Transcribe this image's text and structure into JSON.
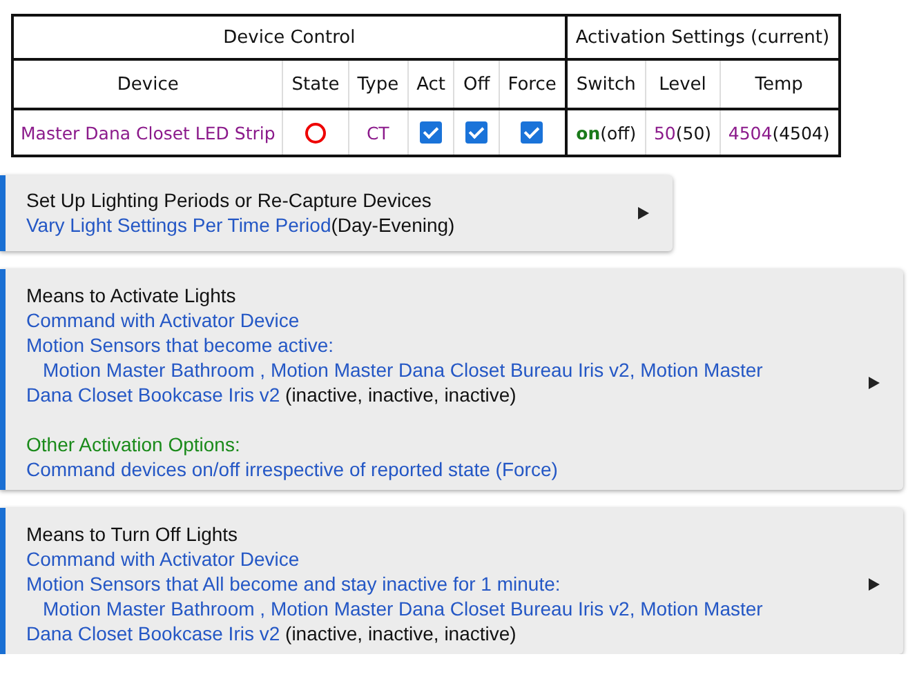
{
  "device_table": {
    "column_groups": [
      {
        "label": "Device Control",
        "columns": [
          "Device",
          "State",
          "Type",
          "Act",
          "Off",
          "Force"
        ]
      },
      {
        "label": "Activation Settings (current)",
        "columns": [
          "Switch",
          "Level",
          "Temp"
        ]
      }
    ],
    "rows": [
      {
        "device": "Master Dana Closet LED Strip",
        "state_on": false,
        "type": "CT",
        "act": {
          "checked": true
        },
        "off": {
          "checked": true
        },
        "force": {
          "checked": true
        },
        "switch": {
          "value": "on",
          "current": "(off)"
        },
        "level": {
          "value": "50",
          "current": "(50)"
        },
        "temp": {
          "value": "4504",
          "current": "(4504)"
        }
      }
    ]
  },
  "panels": [
    {
      "title": "Set Up Lighting Periods or Re-Capture Devices",
      "wide": false,
      "lines": [
        {
          "kind": "link-note",
          "text": "Vary Light Settings Per Time Period",
          "note": "(Day-Evening)"
        }
      ]
    },
    {
      "title": "Means to Activate Lights",
      "wide": true,
      "lines": [
        {
          "kind": "link",
          "text": "Command with Activator Device"
        },
        {
          "kind": "link",
          "text": "Motion Sensors that become active:"
        },
        {
          "kind": "sensors",
          "text": "Motion Master Bathroom , Motion Master Dana Closet Bureau Iris v2, Motion Master Dana Closet Bookcase Iris v2",
          "note": "(inactive, inactive, inactive)"
        },
        {
          "kind": "heading",
          "text": "Other Activation Options:"
        },
        {
          "kind": "link",
          "text": "Command devices on/off irrespective of reported state (Force)"
        }
      ]
    },
    {
      "title": "Means to Turn Off Lights",
      "wide": true,
      "lines": [
        {
          "kind": "link",
          "text": "Command with Activator Device"
        },
        {
          "kind": "link",
          "text": "Motion Sensors that All become and stay inactive for 1 minute:"
        },
        {
          "kind": "sensors",
          "text": "Motion Master Bathroom , Motion Master Dana Closet Bureau Iris v2, Motion Master Dana Closet Bookcase Iris v2",
          "note": "(inactive, inactive, inactive)"
        }
      ]
    }
  ]
}
